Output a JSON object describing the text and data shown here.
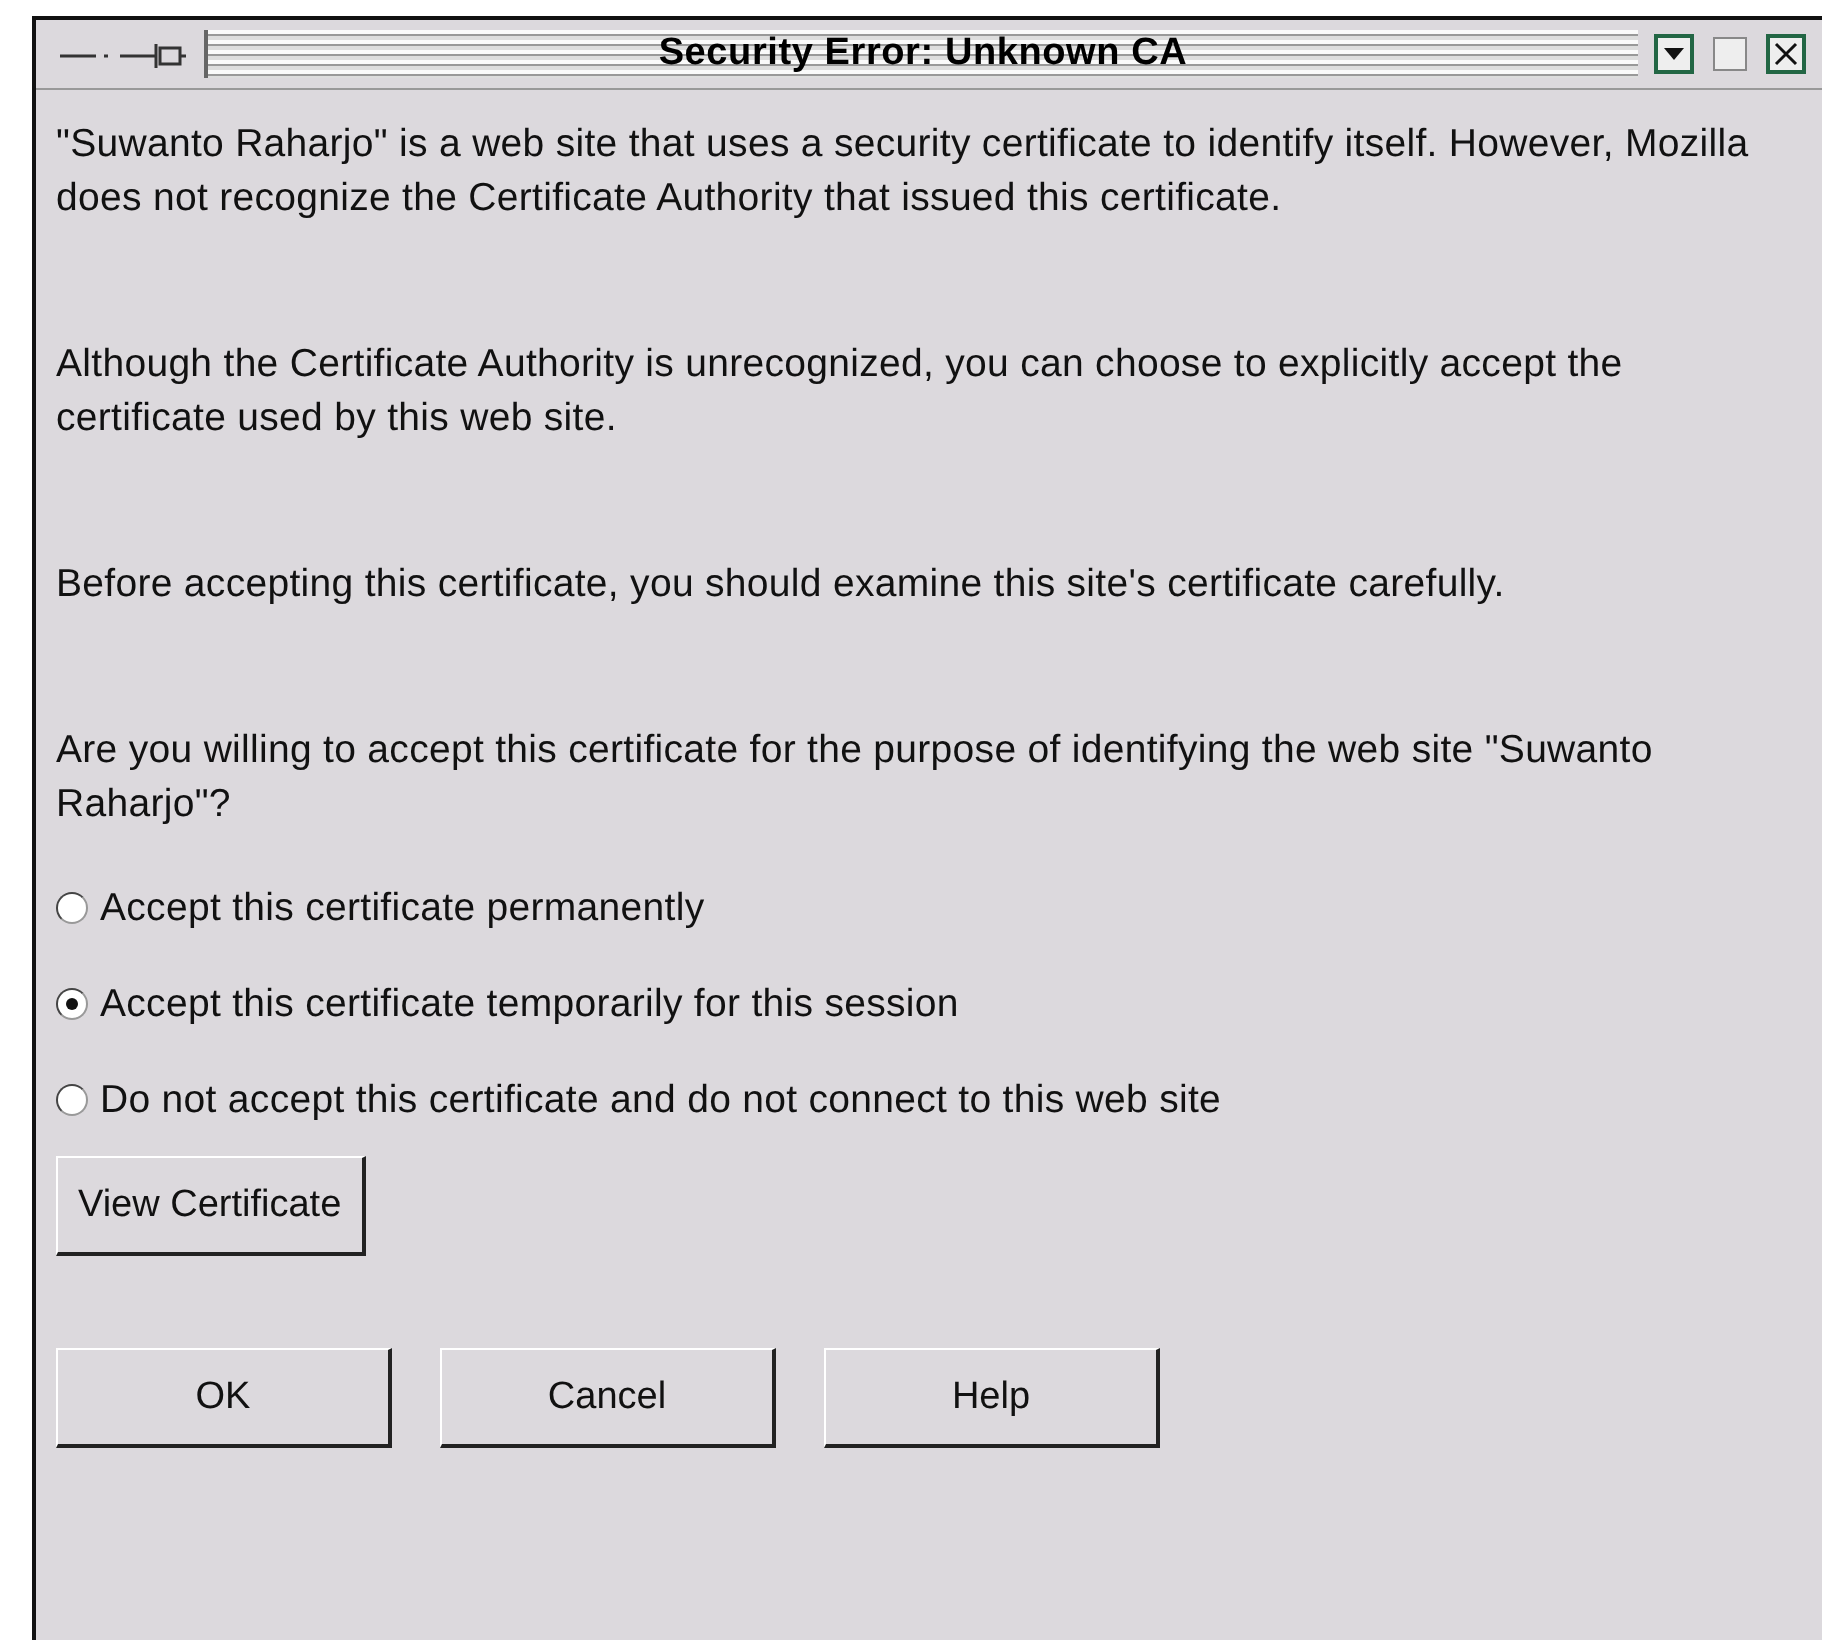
{
  "window": {
    "title": "Security Error: Unknown CA"
  },
  "paragraphs": [
    "\"Suwanto Raharjo\" is a web site that uses a security certificate to identify itself. However, Mozilla does not recognize the Certificate Authority that issued this certificate.",
    "Although the Certificate Authority is unrecognized, you can choose to explicitly accept the certificate used by this web site.",
    "Before accepting this certificate, you should examine this site's certificate carefully.",
    "Are you willing to accept this certificate for the purpose of identifying the web site \"Suwanto Raharjo\"?"
  ],
  "options": [
    {
      "label": "Accept this certificate permanently",
      "selected": false
    },
    {
      "label": "Accept this certificate temporarily for this session",
      "selected": true
    },
    {
      "label": "Do not accept this certificate and do not connect to this web site",
      "selected": false
    }
  ],
  "view_button": "View Certificate",
  "buttons": [
    "OK",
    "Cancel",
    "Help"
  ]
}
